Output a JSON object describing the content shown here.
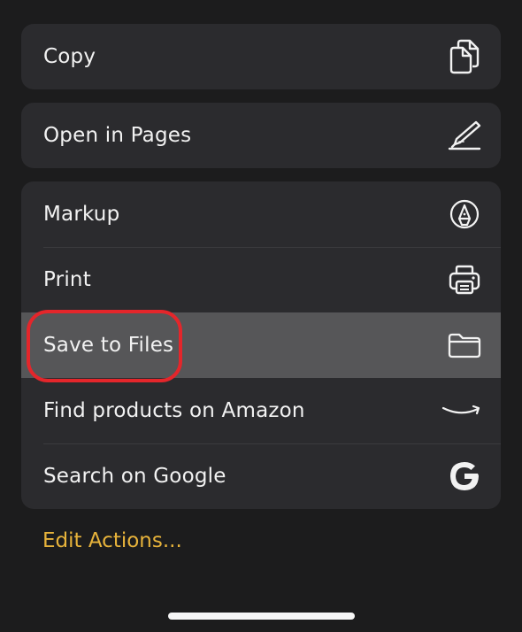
{
  "actions": {
    "copy": {
      "label": "Copy",
      "icon": "copy-icon"
    },
    "open_in_pages": {
      "label": "Open in Pages",
      "icon": "pages-pen-icon"
    },
    "markup": {
      "label": "Markup",
      "icon": "markup-pen-icon"
    },
    "print": {
      "label": "Print",
      "icon": "printer-icon"
    },
    "save_to_files": {
      "label": "Save to Files",
      "icon": "folder-icon"
    },
    "find_on_amazon": {
      "label": "Find products on Amazon",
      "icon": "amazon-smile-icon"
    },
    "search_google": {
      "label": "Search on Google",
      "icon": "google-g-icon"
    }
  },
  "edit_actions_label": "Edit Actions...",
  "colors": {
    "background": "#1c1c1d",
    "row_background": "#2b2b2e",
    "highlight": "#565658",
    "accent": "#e7b33b",
    "callout": "#e4262b"
  }
}
